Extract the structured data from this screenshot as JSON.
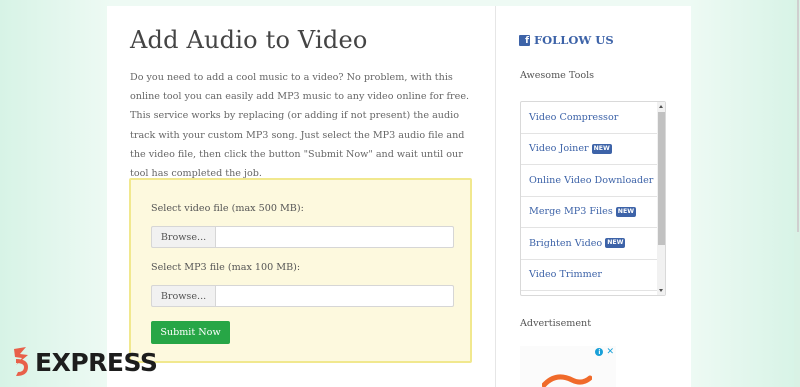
{
  "main": {
    "title": "Add Audio to Video",
    "intro": "Do you need to add a cool music to a video? No problem, with this online tool you can easily add MP3 music to any video online for free. This service works by replacing (or adding if not present) the audio track with your custom MP3 song. Just select the MP3 audio file and the video file, then click the button \"Submit Now\" and wait until our tool has completed the job.",
    "upload": {
      "video_label": "Select video file (max 500 MB):",
      "mp3_label": "Select MP3 file (max 100 MB):",
      "browse_label": "Browse...",
      "submit_label": "Submit Now"
    }
  },
  "sidebar": {
    "follow_label": "FOLLOW US",
    "tools_heading": "Awesome Tools",
    "tools": [
      {
        "label": "Video Compressor",
        "badge": ""
      },
      {
        "label": "Video Joiner",
        "badge": "NEW"
      },
      {
        "label": "Online Video Downloader",
        "badge": ""
      },
      {
        "label": "Merge MP3 Files",
        "badge": "NEW"
      },
      {
        "label": "Brighten Video",
        "badge": "NEW"
      },
      {
        "label": "Video Trimmer",
        "badge": ""
      }
    ],
    "ad_heading": "Advertisement"
  },
  "watermark": {
    "text": "EXPRESS"
  },
  "icons": {
    "facebook": "facebook-icon",
    "ad_info": "info-icon",
    "ad_close": "close-icon",
    "watermark": "logo-mark-icon"
  },
  "colors": {
    "accent": "#3d63a8",
    "submit": "#27a646",
    "upload_bg": "#fdf9de",
    "upload_border": "#f1e88e",
    "page_bg": "#eefaf4"
  }
}
